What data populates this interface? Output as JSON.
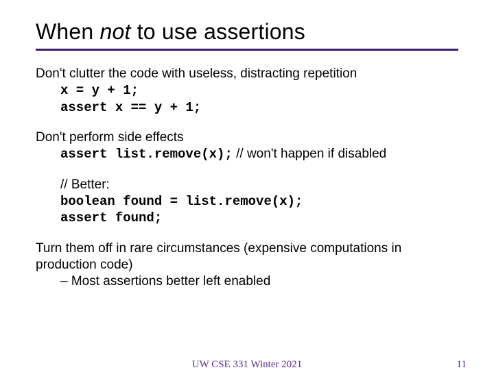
{
  "title": {
    "part1": "When ",
    "emph": "not",
    "part2": " to use assertions"
  },
  "p1": {
    "lead": "Don't clutter the code with useless, distracting repetition",
    "code1": "x = y + 1;",
    "code2": "assert x == y + 1;"
  },
  "p2": {
    "lead": "Don't perform side effects",
    "code": "assert list.remove(x);",
    "comment": " // won't happen if disabled"
  },
  "p3": {
    "comment": "// Better:",
    "code1": "boolean found = list.remove(x);",
    "code2": "assert found;"
  },
  "p4": {
    "lead": "Turn them off in rare circumstances (expensive computations in production code)",
    "bullet": "Most assertions better left enabled"
  },
  "footer": {
    "center": "UW CSE 331 Winter 2021",
    "page": "11"
  }
}
